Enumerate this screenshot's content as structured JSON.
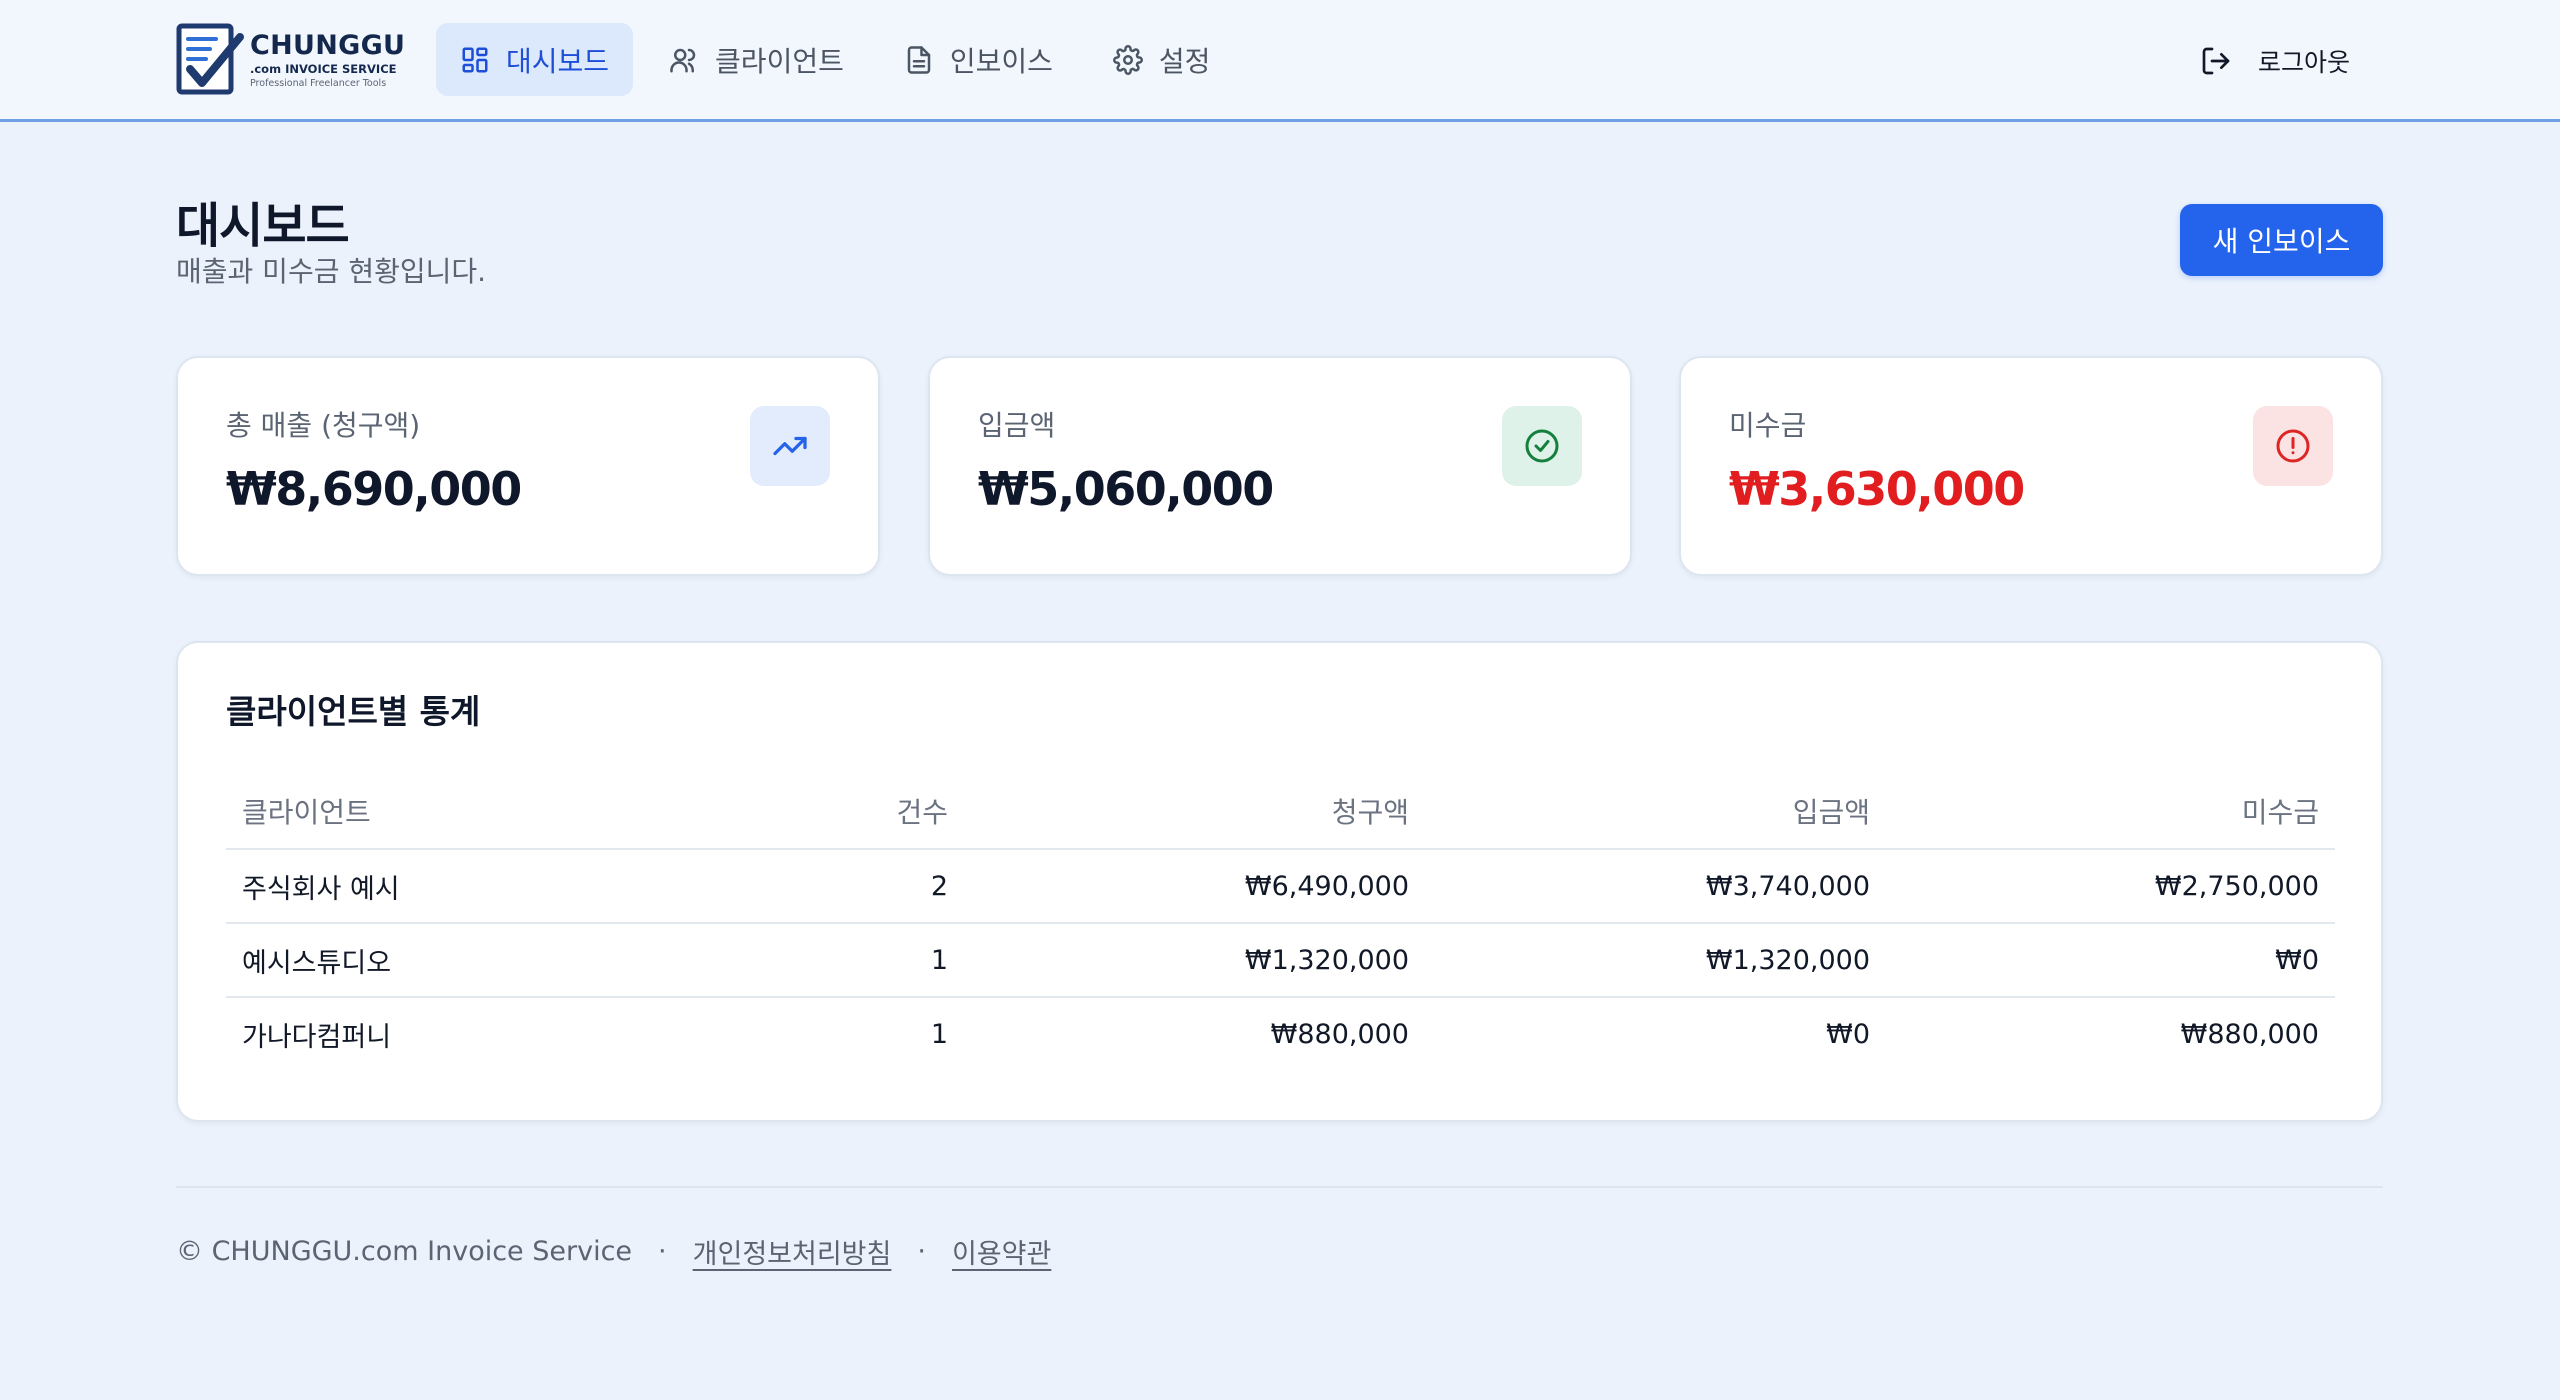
{
  "brand": {
    "name": "CHUNGGU",
    "subtitle": ".com INVOICE SERVICE",
    "tagline": "Professional Freelancer Tools"
  },
  "nav": {
    "items": [
      {
        "label": "대시보드",
        "icon": "dashboard-icon",
        "active": true
      },
      {
        "label": "클라이언트",
        "icon": "users-icon",
        "active": false
      },
      {
        "label": "인보이스",
        "icon": "document-icon",
        "active": false
      },
      {
        "label": "설정",
        "icon": "gear-icon",
        "active": false
      }
    ],
    "logout_label": "로그아웃"
  },
  "page": {
    "title": "대시보드",
    "subtitle": "매출과 미수금 현황입니다.",
    "new_invoice_label": "새 인보이스"
  },
  "stats": [
    {
      "label": "총 매출 (청구액)",
      "value": "₩8,690,000",
      "icon": "trending-up-icon",
      "color": "#2563eb"
    },
    {
      "label": "입금액",
      "value": "₩5,060,000",
      "icon": "check-circle-icon",
      "color": "#16a34a"
    },
    {
      "label": "미수금",
      "value": "₩3,630,000",
      "icon": "alert-circle-icon",
      "color": "#e11d20"
    }
  ],
  "client_stats": {
    "title": "클라이언트별 통계",
    "columns": [
      "클라이언트",
      "건수",
      "청구액",
      "입금액",
      "미수금"
    ],
    "rows": [
      [
        "주식회사 예시",
        "2",
        "₩6,490,000",
        "₩3,740,000",
        "₩2,750,000"
      ],
      [
        "예시스튜디오",
        "1",
        "₩1,320,000",
        "₩1,320,000",
        "₩0"
      ],
      [
        "가나다컴퍼니",
        "1",
        "₩880,000",
        "₩0",
        "₩880,000"
      ]
    ]
  },
  "footer": {
    "copyright": "© CHUNGGU.com Invoice Service",
    "separator": "·",
    "privacy_label": "개인정보처리방침",
    "terms_label": "이용약관"
  },
  "colors": {
    "accent": "#2463eb",
    "background": "#ebf2fc",
    "negative": "#e11d20"
  }
}
